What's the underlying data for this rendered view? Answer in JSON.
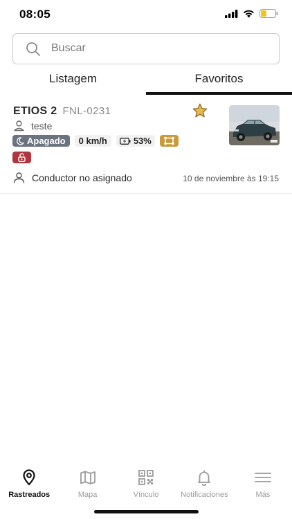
{
  "status_bar": {
    "time": "08:05"
  },
  "search": {
    "placeholder": "Buscar"
  },
  "tabs": [
    {
      "label": "Listagem",
      "active": false
    },
    {
      "label": "Favoritos",
      "active": true
    }
  ],
  "vehicle": {
    "name": "ETIOS 2",
    "plate": "FNL-0231",
    "favorite": true,
    "group": "teste",
    "status": "Apagado",
    "speed": "0 km/h",
    "battery": "53%",
    "driver": "Conductor no asignado",
    "last_update": "10 de noviembre às 19:15",
    "colors": {
      "status_badge": "#6b7280",
      "fence_badge": "#c99a3a",
      "lock_badge": "#b2343c",
      "star": "#e9b84a"
    }
  },
  "bottom_nav": [
    {
      "label": "Rastreados",
      "icon": "location-pin-icon",
      "active": true
    },
    {
      "label": "Mapa",
      "icon": "map-icon",
      "active": false
    },
    {
      "label": "Vínculo",
      "icon": "qr-code-icon",
      "active": false
    },
    {
      "label": "Notificaciones",
      "icon": "bell-icon",
      "active": false
    },
    {
      "label": "Más",
      "icon": "menu-icon",
      "active": false
    }
  ]
}
